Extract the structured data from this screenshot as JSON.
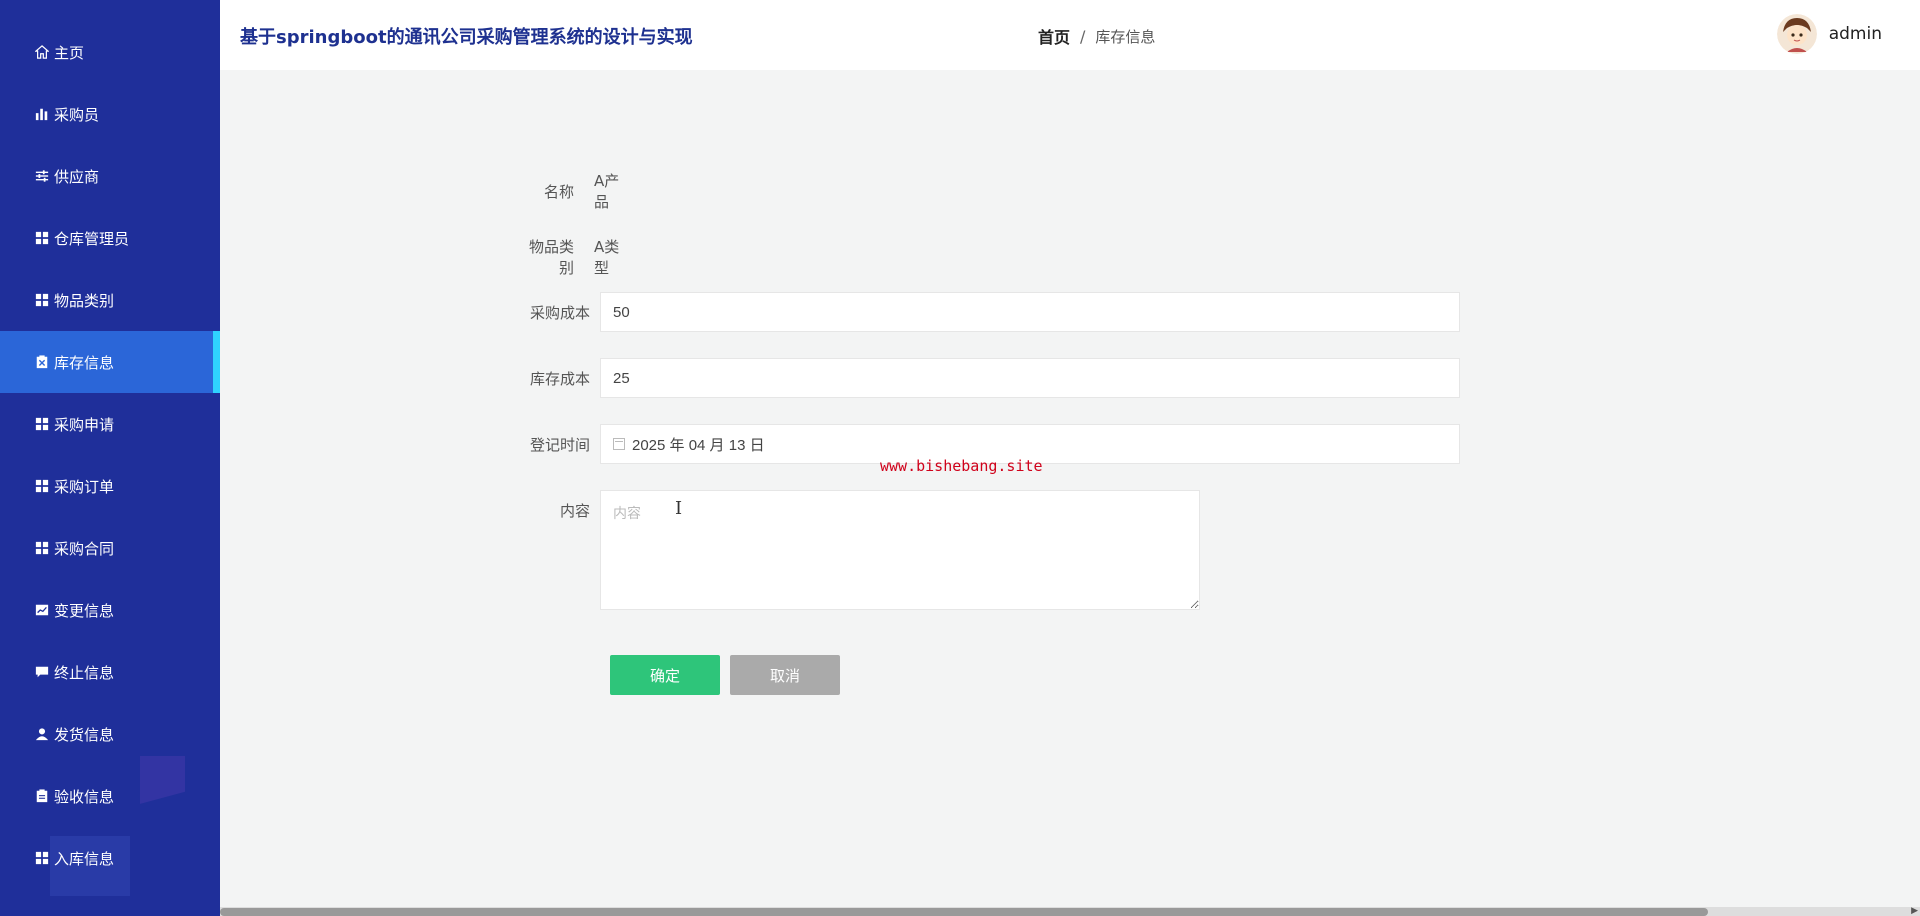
{
  "app_title": "基于springboot的通讯公司采购管理系统的设计与实现",
  "breadcrumb": {
    "home": "首页",
    "separator": "/",
    "current": "库存信息"
  },
  "user": {
    "name": "admin"
  },
  "sidebar": {
    "items": [
      {
        "label": "主页",
        "icon": "home-icon"
      },
      {
        "label": "采购员",
        "icon": "bar-chart-icon"
      },
      {
        "label": "供应商",
        "icon": "sliders-icon"
      },
      {
        "label": "仓库管理员",
        "icon": "grid-icon"
      },
      {
        "label": "物品类别",
        "icon": "grid-icon"
      },
      {
        "label": "库存信息",
        "icon": "clipboard-x-icon",
        "active": true
      },
      {
        "label": "采购申请",
        "icon": "grid-icon"
      },
      {
        "label": "采购订单",
        "icon": "grid-icon"
      },
      {
        "label": "采购合同",
        "icon": "grid-icon"
      },
      {
        "label": "变更信息",
        "icon": "trend-chart-icon"
      },
      {
        "label": "终止信息",
        "icon": "comment-icon"
      },
      {
        "label": "发货信息",
        "icon": "user-icon"
      },
      {
        "label": "验收信息",
        "icon": "clipboard-icon"
      },
      {
        "label": "入库信息",
        "icon": "grid-icon"
      }
    ]
  },
  "form": {
    "name": {
      "label": "名称",
      "value": "A产品"
    },
    "category": {
      "label": "物品类别",
      "value": "A类型"
    },
    "purchase_cost": {
      "label": "采购成本",
      "value": "50"
    },
    "stock_cost": {
      "label": "库存成本",
      "value": "25"
    },
    "register_time": {
      "label": "登记时间",
      "value": "2025 年 04 月 13 日"
    },
    "content": {
      "label": "内容",
      "placeholder": "内容",
      "value": ""
    },
    "confirm_label": "确定",
    "cancel_label": "取消"
  },
  "watermark": "www.bishebang.site",
  "colors": {
    "sidebar": "#1f2f9a",
    "active": "#2b66d8",
    "confirm": "#2ec57a",
    "cancel": "#aaaaaa",
    "title": "#1e3190"
  }
}
